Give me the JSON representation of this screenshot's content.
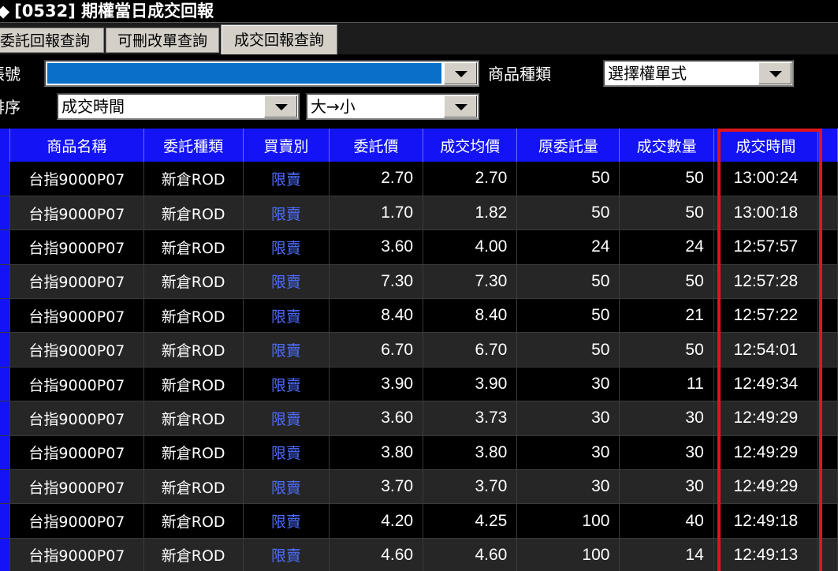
{
  "window": {
    "title": "[0532] 期權當日成交回報",
    "title_glyph": "◆"
  },
  "tabs": [
    {
      "label": "委託回報查詢",
      "active": false
    },
    {
      "label": "可刪改單查詢",
      "active": false
    },
    {
      "label": "成交回報查詢",
      "active": true
    }
  ],
  "filters": {
    "account_label": "帳號",
    "account_value": "",
    "product_type_label": "商品種類",
    "product_type_value": "選擇權單式",
    "sort_label": "排序",
    "sort_field_value": "成交時間",
    "sort_order_value": "大→小"
  },
  "colors": {
    "header_bg": "#1313f5",
    "account_highlight": "#0870c8",
    "sell_text": "#4f6dff",
    "highlight_border": "#e0151b"
  },
  "table": {
    "columns": [
      "商品名稱",
      "委託種類",
      "買賣別",
      "委託價",
      "成交均價",
      "原委託量",
      "成交數量",
      "成交時間"
    ],
    "rows": [
      [
        "台指9000P07",
        "新倉ROD",
        "限賣",
        "2.70",
        "2.70",
        "50",
        "50",
        "13:00:24"
      ],
      [
        "台指9000P07",
        "新倉ROD",
        "限賣",
        "1.70",
        "1.82",
        "50",
        "50",
        "13:00:18"
      ],
      [
        "台指9000P07",
        "新倉ROD",
        "限賣",
        "3.60",
        "4.00",
        "24",
        "24",
        "12:57:57"
      ],
      [
        "台指9000P07",
        "新倉ROD",
        "限賣",
        "7.30",
        "7.30",
        "50",
        "50",
        "12:57:28"
      ],
      [
        "台指9000P07",
        "新倉ROD",
        "限賣",
        "8.40",
        "8.40",
        "50",
        "21",
        "12:57:22"
      ],
      [
        "台指9000P07",
        "新倉ROD",
        "限賣",
        "6.70",
        "6.70",
        "50",
        "50",
        "12:54:01"
      ],
      [
        "台指9000P07",
        "新倉ROD",
        "限賣",
        "3.90",
        "3.90",
        "30",
        "11",
        "12:49:34"
      ],
      [
        "台指9000P07",
        "新倉ROD",
        "限賣",
        "3.60",
        "3.73",
        "30",
        "30",
        "12:49:29"
      ],
      [
        "台指9000P07",
        "新倉ROD",
        "限賣",
        "3.80",
        "3.80",
        "30",
        "30",
        "12:49:29"
      ],
      [
        "台指9000P07",
        "新倉ROD",
        "限賣",
        "3.70",
        "3.70",
        "30",
        "30",
        "12:49:29"
      ],
      [
        "台指9000P07",
        "新倉ROD",
        "限賣",
        "4.20",
        "4.25",
        "100",
        "40",
        "12:49:18"
      ],
      [
        "台指9000P07",
        "新倉ROD",
        "限賣",
        "4.60",
        "4.60",
        "100",
        "14",
        "12:49:13"
      ]
    ]
  }
}
